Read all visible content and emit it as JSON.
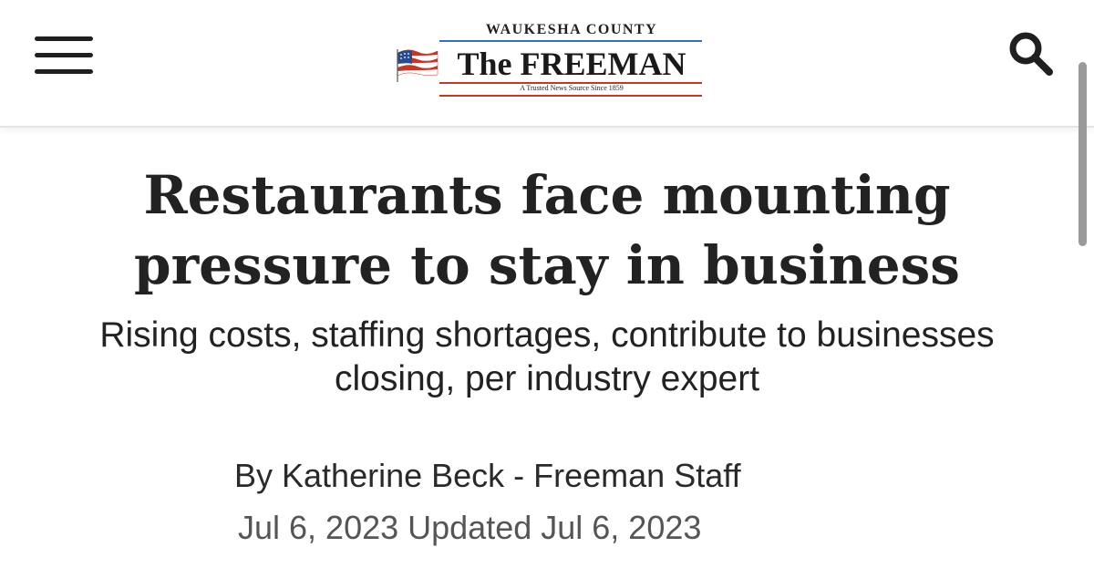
{
  "header": {
    "menu_icon": "hamburger-menu-icon",
    "search_icon": "search-icon",
    "masthead": {
      "county": "WAUKESHA COUNTY",
      "name": "The FREEMAN",
      "tagline": "A Trusted News Source Since 1859",
      "flag_icon": "american-flag-icon",
      "colors": {
        "accent_blue": "#3b6fb6",
        "accent_red": "#c0392b"
      }
    }
  },
  "article": {
    "headline": "Restaurants face mounting pressure to stay in business",
    "subheadline": "Rising costs, staffing shortages, contribute to businesses closing, per industry expert",
    "byline": "By Katherine Beck - Freeman Staff",
    "dateline": "Jul 6, 2023 Updated Jul 6, 2023"
  }
}
